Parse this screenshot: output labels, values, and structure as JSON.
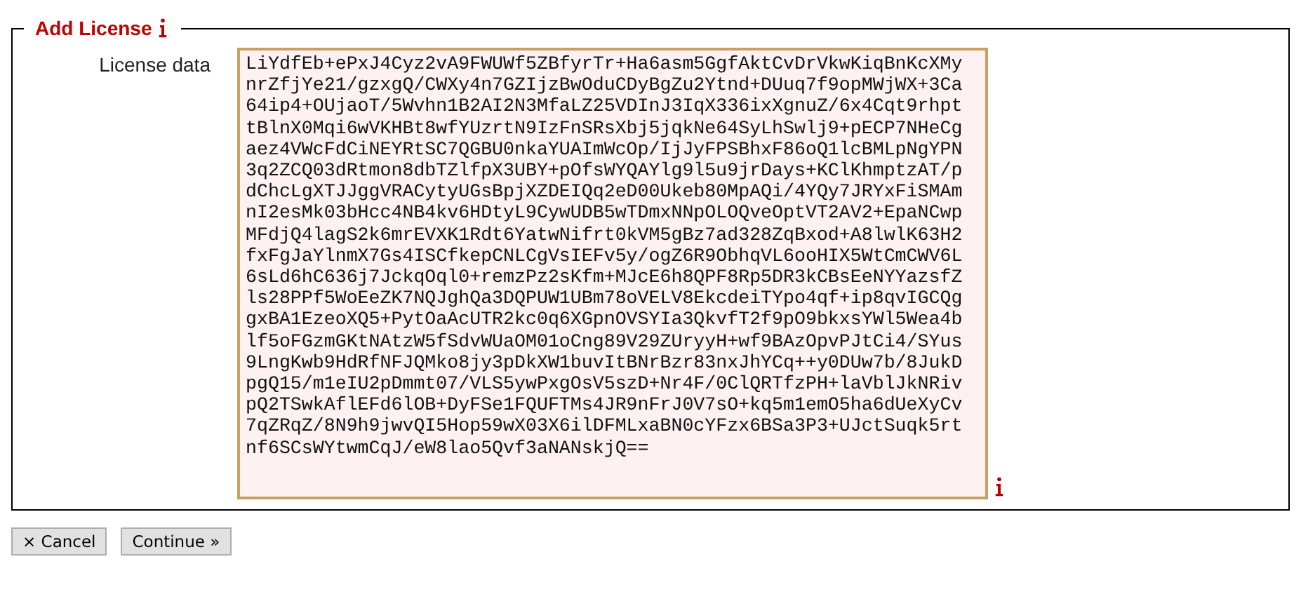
{
  "form": {
    "legend": "Add License",
    "legend_info": true,
    "fields": [
      {
        "label": "License data",
        "info": true,
        "value": "LiYdfEb+ePxJ4Cyz2vA9FWUWf5ZBfyrTr+Ha6asm5GgfAktCvDrVkwKiqBnKcXMy\nnrZfjYe21/gzxgQ/CWXy4n7GZIjzBwOduCDyBgZu2Ytnd+DUuq7f9opMWjWX+3Ca\n64ip4+OUjaoT/5Wvhn1B2AI2N3MfaLZ25VDInJ3IqX336ixXgnuZ/6x4Cqt9rhpt\ntBlnX0Mqi6wVKHBt8wfYUzrtN9IzFnSRsXbj5jqkNe64SyLhSwlj9+pECP7NHeCg\naez4VWcFdCiNEYRtSC7QGBU0nkaYUAImWcOp/IjJyFPSBhxF86oQ1lcBMLpNgYPN\n3q2ZCQ03dRtmon8dbTZlfpX3UBY+pOfsWYQAYlg9l5u9jrDays+KClKhmptzAT/p\ndChcLgXTJJggVRACytyUGsBpjXZDEIQq2eD00Ukeb80MpAQi/4YQy7JRYxFiSMAm\nnI2esMk03bHcc4NB4kv6HDtyL9CywUDB5wTDmxNNpOLOQveOptVT2AV2+EpaNCwp\nMFdjQ4lagS2k6mrEVXK1Rdt6YatwNifrt0kVM5gBz7ad328ZqBxod+A8lwlK63H2\nfxFgJaYlnmX7Gs4ISCfkepCNLCgVsIEFv5y/ogZ6R9ObhqVL6ooHIX5WtCmCWV6L\n6sLd6hC636j7JckqOql0+remzPz2sKfm+MJcE6h8QPF8Rp5DR3kCBsEeNYYazsfZ\nls28PPf5WoEeZK7NQJghQa3DQPUW1UBm78oVELV8EkcdeiTYpo4qf+ip8qvIGCQg\ngxBA1EzeoXQ5+PytOaAcUTR2kc0q6XGpnOVSYIa3QkvfT2f9pO9bkxsYWl5Wea4b\nlf5oFGzmGKtNAtzW5fSdvWUaOM01oCng89V29ZUryyH+wf9BAzOpvPJtCi4/SYus\n9LngKwb9HdRfNFJQMko8jy3pDkXW1buvItBNrBzr83nxJhYCq++y0DUw7b/8JukD\npgQ15/m1eIU2pDmmt07/VLS5ywPxgOsV5szD+Nr4F/0ClQRTfzPH+laVblJkNRiv\npQ2TSwkAflEFd6lOB+DyFSe1FQUFTMs4JR9nFrJ0V7sO+kq5m1emO5ha6dUeXyCv\n7qZRqZ/8N9h9jwvQI5Hop59wX03X6ilDFMLxaBN0cYFzx6BSa3P3+UJctSuqk5rt\nnf6SCsWYtwmCqJ/eW8lao5Qvf3aNANskjQ=="
      }
    ]
  },
  "buttons": [
    {
      "label": "× Cancel"
    },
    {
      "label": "Continue »"
    }
  ]
}
